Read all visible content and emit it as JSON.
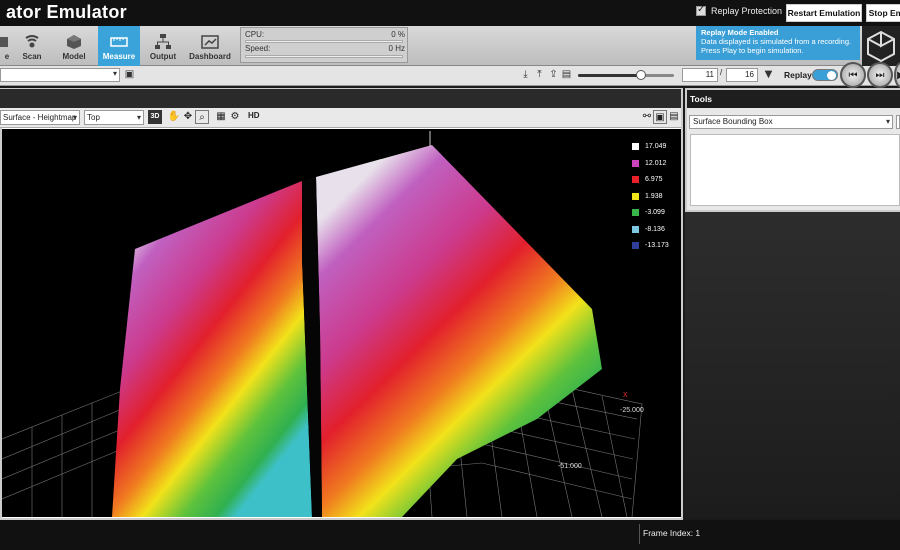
{
  "window": {
    "title": "ator Emulator",
    "replay_protection_label": "Replay Protection",
    "restart_label": "Restart Emulation",
    "stop_label": "Stop Em"
  },
  "toolbar": {
    "tabs": [
      {
        "label": "e",
        "icon": "partial-tool-icon"
      },
      {
        "label": "Scan",
        "icon": "scan-icon"
      },
      {
        "label": "Model",
        "icon": "model-cube-icon"
      },
      {
        "label": "Measure",
        "icon": "measure-ruler-icon",
        "active": true
      },
      {
        "label": "Output",
        "icon": "output-network-icon"
      },
      {
        "label": "Dashboard",
        "icon": "dashboard-icon"
      }
    ],
    "cpu_label": "CPU:",
    "cpu_value": "0 %",
    "speed_label": "Speed:",
    "speed_value": "0 Hz",
    "replay_note_title": "Replay Mode Enabled",
    "replay_note_line1": "Data displayed is simulated from a recording.",
    "replay_note_line2": "Press Play to begin simulation."
  },
  "playback": {
    "current_frame": "11",
    "total_frames": "16",
    "replay_label": "Replay",
    "slider_fraction": 0.65,
    "replay_enabled": true
  },
  "viewer": {
    "view_mode": "Surface - Heightmap",
    "view_angle": "Top",
    "hd_label": "HD",
    "mode_3d_label": "3D"
  },
  "legend": [
    {
      "value": "17.049",
      "color": "#ffffff"
    },
    {
      "value": "12.012",
      "color": "#cc44bb"
    },
    {
      "value": "6.975",
      "color": "#e8202a"
    },
    {
      "value": "1.938",
      "color": "#f2e21a"
    },
    {
      "value": "-3.099",
      "color": "#39b54a"
    },
    {
      "value": "-8.136",
      "color": "#7ec8e3"
    },
    {
      "value": "-13.173",
      "color": "#2e3e9a"
    }
  ],
  "axes": {
    "x_label": "X",
    "x_tick": "-25.000",
    "y_tick": "-51.000"
  },
  "tools": {
    "header": "Tools",
    "selected_tool": "Surface Bounding Box"
  },
  "status": {
    "frame_index": "Frame Index: 1"
  }
}
